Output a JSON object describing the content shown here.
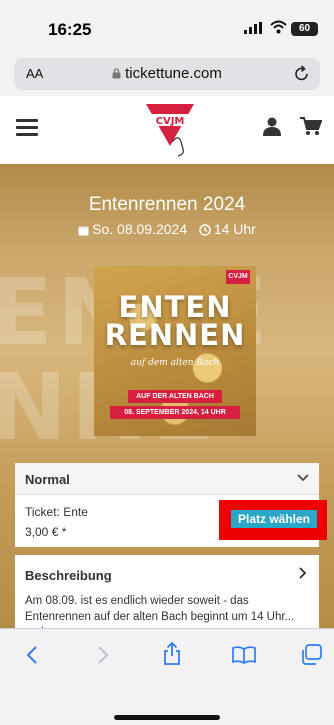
{
  "status_bar": {
    "time": "16:25",
    "battery": "60"
  },
  "browser": {
    "text_size_label": "AA",
    "url": "tickettune.com"
  },
  "site": {
    "logo_text": "CVJM"
  },
  "event": {
    "title": "Entenrennen 2024",
    "date": "So. 08.09.2024",
    "time": "14 Uhr",
    "background_text": [
      "ENTE",
      "NNE"
    ]
  },
  "poster": {
    "logo_text": "CVJM",
    "line1": "ENTEN",
    "line2": "RENNEN",
    "script": "auf dem alten Bach",
    "band1": "AUF DER ALTEN BACH",
    "band2": "08. SEPTEMBER 2024, 14 UHR"
  },
  "ticket_section": {
    "category": "Normal",
    "ticket_name": "Ticket: Ente",
    "price": "3,00 € *",
    "select_button": "Platz wählen"
  },
  "description": {
    "heading": "Beschreibung",
    "text": "Am 08.09. ist es endlich wieder soweit - das Entenrennen auf der alten Bach beginnt um 14 Uhr...",
    "more_link": "mehr"
  },
  "colors": {
    "accent": "#2aa6c9",
    "brand_red": "#d71f3f",
    "highlight": "#ee0000"
  }
}
